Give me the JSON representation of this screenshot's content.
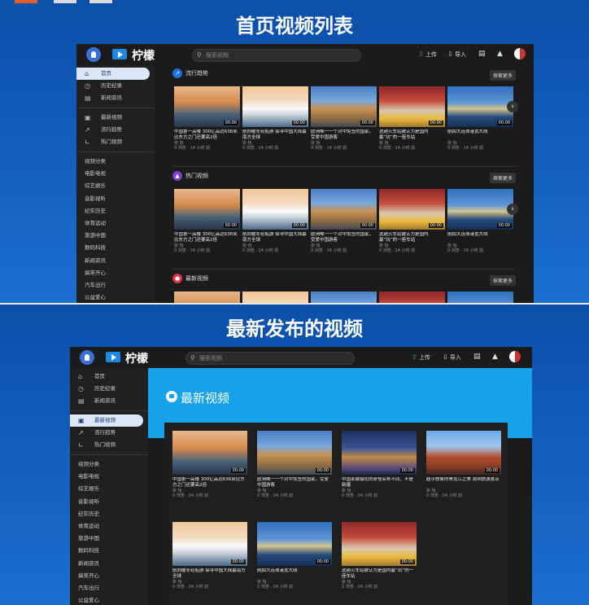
{
  "section1": {
    "title": "首页视频列表"
  },
  "section2": {
    "title": "最新发布的视频"
  },
  "app": {
    "logo": "柠檬",
    "search_placeholder": "搜索视频",
    "upload": "上传",
    "import": "导入"
  },
  "sidebar1": {
    "main": [
      {
        "label": "首页",
        "icon": "home-icon"
      },
      {
        "label": "历史纪录",
        "icon": "history-icon"
      },
      {
        "label": "新闻资讯",
        "icon": "news-icon"
      }
    ],
    "secondary": [
      {
        "label": "最新视频",
        "icon": "video-icon"
      },
      {
        "label": "流行趋势",
        "icon": "trend-icon"
      },
      {
        "label": "热门视频",
        "icon": "chart-icon"
      }
    ],
    "categories": [
      "视频分类",
      "电影电视",
      "综艺娱乐",
      "音影视听",
      "纪实历史",
      "体育运动",
      "旅游中国",
      "数码科技",
      "新闻资讯",
      "搞笑开心",
      "汽车出行",
      "公益爱心"
    ]
  },
  "sidebar2": {
    "main": [
      {
        "label": "首页",
        "icon": "home-icon"
      },
      {
        "label": "历史纪录",
        "icon": "history-icon"
      },
      {
        "label": "新闻资讯",
        "icon": "news-icon"
      }
    ],
    "secondary": [
      {
        "label": "最新视频",
        "icon": "video-icon"
      },
      {
        "label": "流行趋势",
        "icon": "trend-icon"
      },
      {
        "label": "热门视频",
        "icon": "chart-icon"
      }
    ],
    "categories": [
      "视频分类",
      "电影电视",
      "综艺娱乐",
      "音影视听",
      "纪实历史",
      "体育运动",
      "旅游中国",
      "数码科技",
      "新闻资讯",
      "搞笑开心",
      "汽车出行",
      "公益爱心"
    ]
  },
  "shelves": [
    {
      "title": "流行趋势",
      "more": "探索更多",
      "icon": "trend-icon",
      "color": "#1e6fd9"
    },
    {
      "title": "热门视频",
      "more": "探索更多",
      "icon": "fire-icon",
      "color": "#7a3fd0"
    },
    {
      "title": "最新视频",
      "more": "探索更多",
      "icon": "video-icon",
      "color": "#e0304a"
    }
  ],
  "videos": [
    {
      "title": "中国第一高楼 300亿高达636米 比东方之门还要高2倍",
      "author": "张 怡",
      "meta": "0 浏览 · 14 小时 前",
      "duration": "00:00",
      "thumb": "t-sunset"
    },
    {
      "title": "航向暖冬轮船游 探寻中国大陆最南方全球",
      "author": "张 怡",
      "meta": "0 浏览 · 14 小时 前",
      "duration": "00:00",
      "thumb": "t-ship"
    },
    {
      "title": "欧洲唯一一个对中免签的国家，受爱中国游客",
      "author": "张 怡",
      "meta": "0 浏览 · 14 小时 前",
      "duration": "00:00",
      "thumb": "t-castle"
    },
    {
      "title": "这趟火车站被认为是国内最“坑”的一座车站",
      "author": "张 怡",
      "meta": "0 浏览 · 14 小时 前",
      "duration": "00:00",
      "thumb": "t-station"
    },
    {
      "title": "航拍大连珠港宽大线",
      "author": "张 怡",
      "meta": "0 浏览 · 14 小时 前",
      "duration": "00:00",
      "thumb": "t-bridge"
    }
  ],
  "latest": {
    "hero_title": "最新视频",
    "videos": [
      {
        "title": "中国第一高楼 300亿高达636米比东方之门还要高2倍",
        "author": "张 怡",
        "meta": "0 浏览 · 14 小时 前",
        "duration": "00:00",
        "thumb": "t-sunset"
      },
      {
        "title": "欧洲唯一一个对中免签的国家，受爱中国游客",
        "author": "张 怡",
        "meta": "2 浏览 · 14 小时 前",
        "duration": "00:00",
        "thumb": "t-castle"
      },
      {
        "title": "中国某城镇化的奇怪名称不同，不是新疆",
        "author": "张 怡",
        "meta": "0 浏览 · 14 小时 前",
        "duration": "00:00",
        "thumb": "t-night"
      },
      {
        "title": "超乎想象的黑龙江之美 昆明旅游景点",
        "author": "张 怡",
        "meta": "0 浏览 · 14 小时 前",
        "duration": "00:00",
        "thumb": "t-palace"
      },
      {
        "title": "航向暖冬轮船游 探寻中国大陆最南方全球",
        "author": "张 怡",
        "meta": "0 浏览 · 14 小时 前",
        "duration": "00:00",
        "thumb": "t-ship"
      },
      {
        "title": "航拍大连珠港宽大线",
        "author": "张 怡",
        "meta": "2 浏览 · 14 小时 前",
        "duration": "00:00",
        "thumb": "t-bridge"
      },
      {
        "title": "这趟火车站被认为是国内最“坑”的一座车站",
        "author": "张 怡",
        "meta": "1 浏览 · 14 小时 前",
        "duration": "00:00",
        "thumb": "t-station"
      }
    ]
  }
}
